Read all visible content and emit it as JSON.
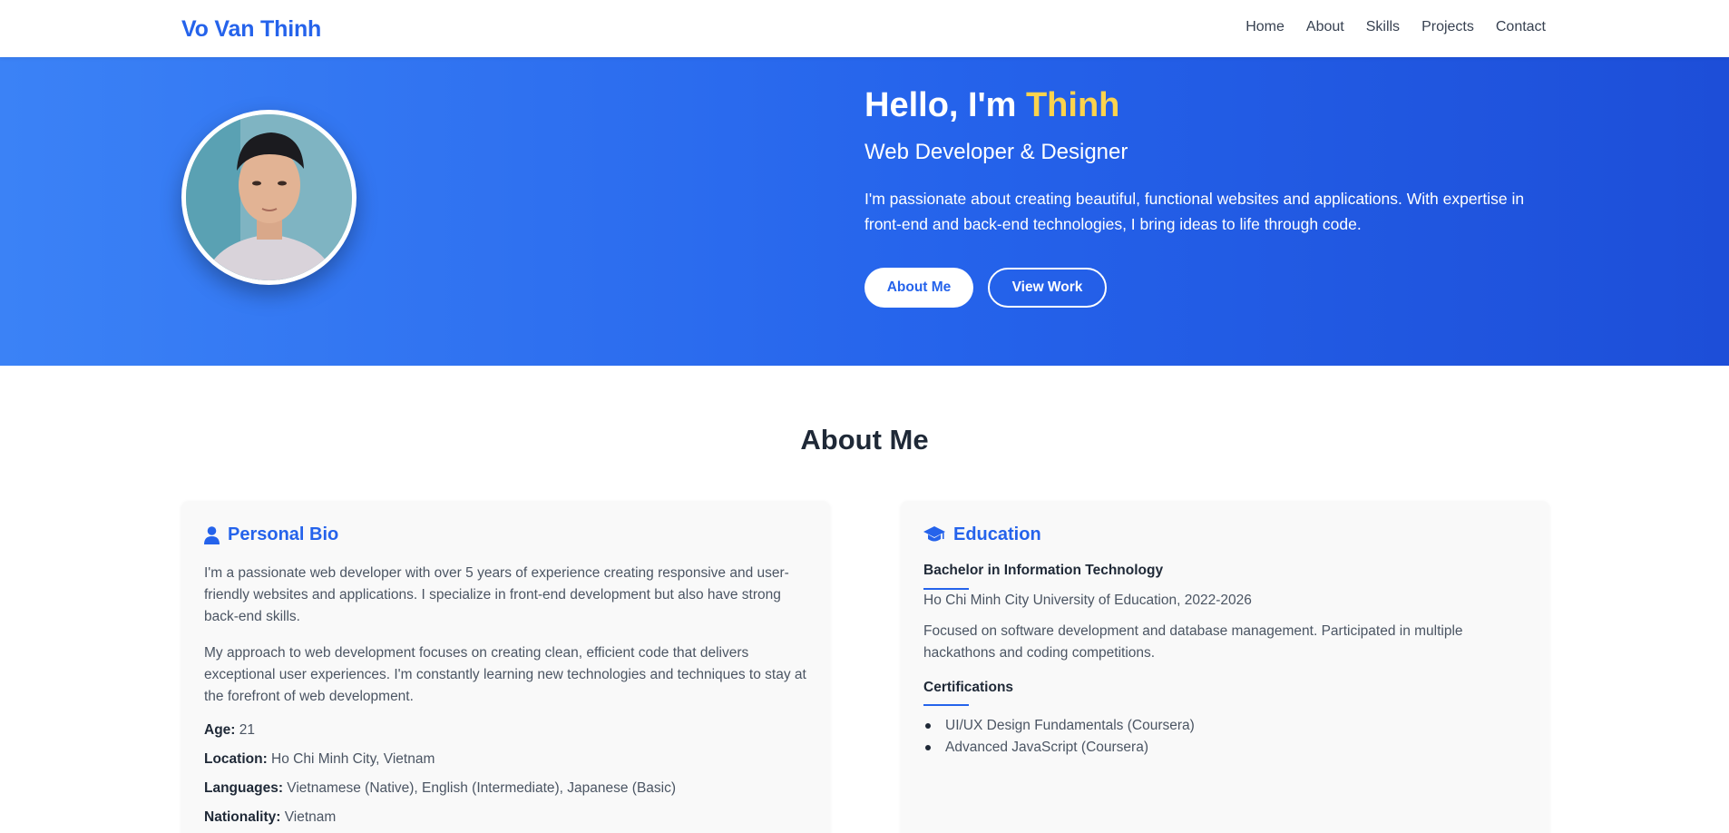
{
  "nav": {
    "brand": "Vo Van Thinh",
    "links": [
      "Home",
      "About",
      "Skills",
      "Projects",
      "Contact"
    ]
  },
  "hero": {
    "greeting": "Hello, I'm ",
    "name": "Thinh",
    "subtitle": "Web Developer & Designer",
    "description": "I'm passionate about creating beautiful, functional websites and applications. With expertise in front-end and back-end technologies, I bring ideas to life through code.",
    "primary_button": "About Me",
    "secondary_button": "View Work"
  },
  "about": {
    "title": "About Me",
    "bio": {
      "heading": "Personal Bio",
      "icon": "user-icon",
      "paragraph_1": "I'm a passionate web developer with over 5 years of experience creating responsive and user-friendly websites and applications. I specialize in front-end development but also have strong back-end skills.",
      "paragraph_2": "My approach to web development focuses on creating clean, efficient code that delivers exceptional user experiences. I'm constantly learning new technologies and techniques to stay at the forefront of web development.",
      "details": [
        {
          "label": "Age:",
          "value": " 21"
        },
        {
          "label": "Location:",
          "value": " Ho Chi Minh City, Vietnam"
        },
        {
          "label": "Languages:",
          "value": " Vietnamese (Native), English (Intermediate), Japanese (Basic)"
        },
        {
          "label": "Nationality:",
          "value": " Vietnam"
        }
      ]
    },
    "education": {
      "heading": "Education",
      "icon": "graduation-cap-icon",
      "degree": "Bachelor in Information Technology",
      "school": "Ho Chi Minh City University of Education, 2022-2026",
      "description": "Focused on software development and database management. Participated in multiple hackathons and coding competitions.",
      "certifications_title": "Certifications",
      "certifications": [
        "UI/UX Design Fundamentals (Coursera)",
        "Advanced JavaScript (Coursera)"
      ]
    }
  },
  "colors": {
    "accent": "#2563eb",
    "highlight": "#fcd34d",
    "hero_start": "#3b82f6",
    "hero_end": "#1d4ed8"
  }
}
